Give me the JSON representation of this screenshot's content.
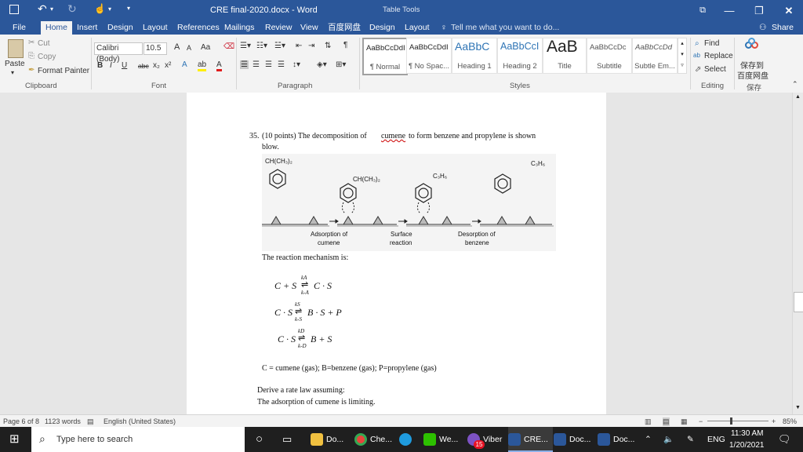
{
  "window": {
    "title": "CRE final-2020.docx - Word",
    "context_title": "Table Tools"
  },
  "quick_access": {
    "save_icon": "save-icon",
    "undo_icon": "undo-icon",
    "redo_icon": "redo-icon",
    "touch_icon": "touch-mode-icon"
  },
  "tabs": [
    "File",
    "Home",
    "Insert",
    "Design",
    "Layout",
    "References",
    "Mailings",
    "Review",
    "View",
    "百度网盘",
    "Design",
    "Layout"
  ],
  "active_tab": "Home",
  "tell_me": "Tell me what you want to do...",
  "share": "Share",
  "clipboard": {
    "paste": "Paste",
    "cut": "Cut",
    "copy": "Copy",
    "format_painter": "Format Painter",
    "label": "Clipboard"
  },
  "font": {
    "name": "Calibri (Body)",
    "size": "10.5",
    "label": "Font",
    "bold": "B",
    "italic": "I",
    "underline": "U",
    "strike": "abc",
    "sub": "x₂",
    "sup": "x²",
    "grow": "A",
    "shrink": "A",
    "case": "Aa"
  },
  "paragraph": {
    "label": "Paragraph"
  },
  "styles": {
    "label": "Styles",
    "items": [
      {
        "sample": "AaBbCcDdI",
        "name": "¶ Normal"
      },
      {
        "sample": "AaBbCcDdI",
        "name": "¶ No Spac..."
      },
      {
        "sample": "AaBbC",
        "name": "Heading 1"
      },
      {
        "sample": "AaBbCcI",
        "name": "Heading 2"
      },
      {
        "sample": "AaB",
        "name": "Title"
      },
      {
        "sample": "AaBbCcDc",
        "name": "Subtitle"
      },
      {
        "sample": "AaBbCcDd",
        "name": "Subtle Em..."
      }
    ]
  },
  "editing": {
    "find": "Find",
    "replace": "Replace",
    "select": "Select",
    "label": "Editing"
  },
  "baidu": {
    "line1": "保存到",
    "line2": "百度网盘",
    "label": "保存"
  },
  "document": {
    "q_number": "35.",
    "q_text": "(10 points) The decomposition of",
    "q_word": "cumene",
    "q_text2": "to form benzene and propylene is shown",
    "q_line2": "blow.",
    "fig": {
      "sub1": "CH(CH₃)₂",
      "sub2": "CH(CH₃)₂",
      "sub3": "C₃H₆",
      "sub4": "C₃H₆",
      "label1a": "Adsorption of",
      "label1b": "cumene",
      "label2a": "Surface",
      "label2b": "reaction",
      "label3a": "Desorption of",
      "label3b": "benzene"
    },
    "mechanism_intro": "The reaction mechanism is:",
    "eq1": {
      "lhs": "C + S",
      "rhs": "C · S",
      "k_top": "kA",
      "k_bot": "k-A"
    },
    "eq2": {
      "lhs": "C · S",
      "rhs": "B · S + P",
      "k_top": "kS",
      "k_bot": "k-S"
    },
    "eq3": {
      "lhs": "C · S",
      "rhs": "B + S",
      "k_top": "kD",
      "k_bot": "k-D"
    },
    "definitions": "C = cumene (gas); B=benzene (gas); P=propylene (gas)",
    "derive": "Derive a rate law assuming:",
    "assumption": "The adsorption of cumene is limiting."
  },
  "status": {
    "page": "Page 6 of 8",
    "words": "1123 words",
    "language": "English (United States)",
    "zoom": "85%"
  },
  "taskbar": {
    "search": "Type here to search",
    "apps": [
      "Do...",
      "Che...",
      "We...",
      "Viber",
      "CRE...",
      "Doc...",
      "Doc..."
    ],
    "viber_badge": "15",
    "lang": "ENG",
    "time": "11:30 AM",
    "date": "1/20/2021"
  },
  "colors": {
    "word_blue": "#2b579a",
    "taskbar": "#1f1f1f",
    "heading_blue": "#2e74b5"
  }
}
